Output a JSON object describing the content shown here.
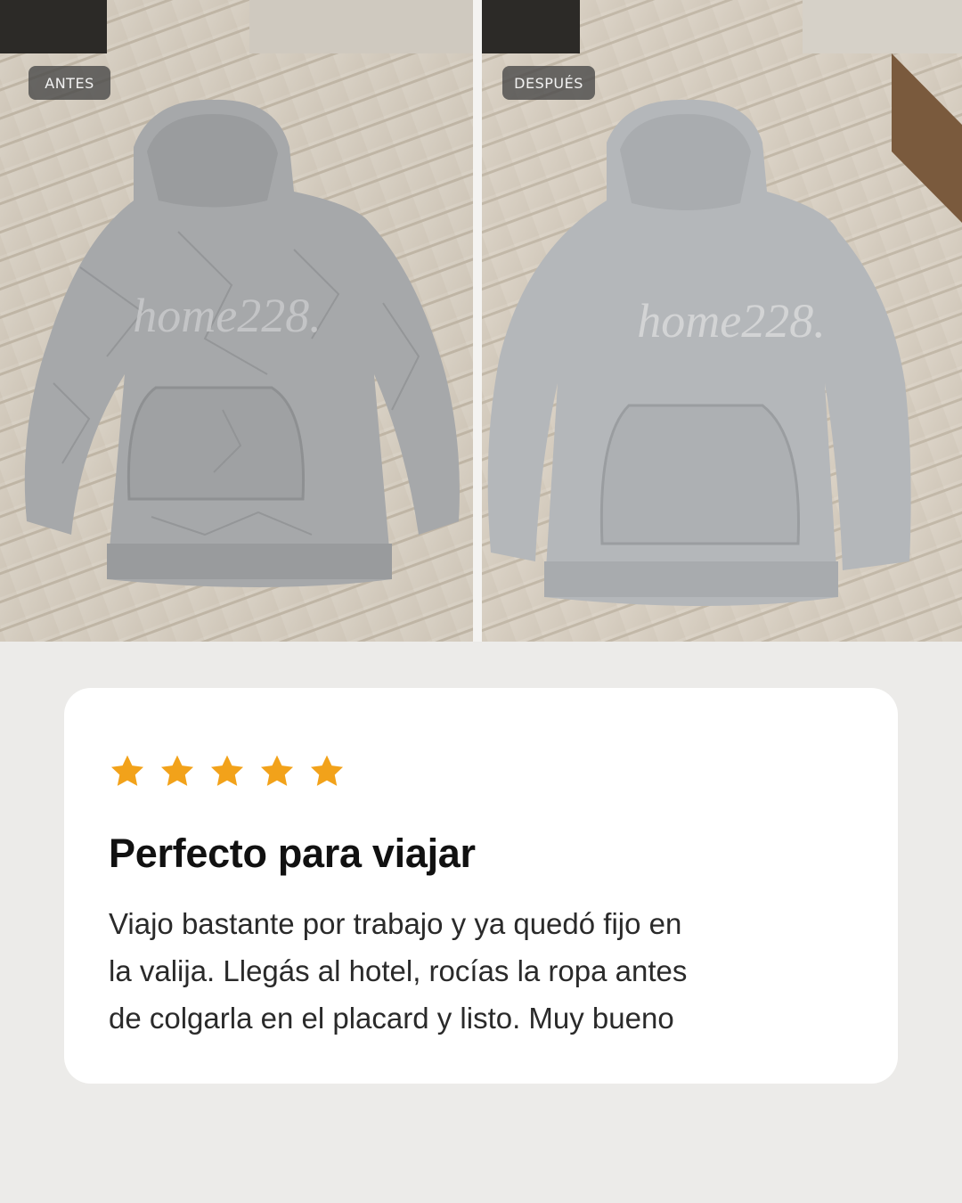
{
  "photos": {
    "before": {
      "label": "ANTES",
      "watermark": "home228."
    },
    "after": {
      "label": "DESPUÉS",
      "watermark": "home228."
    }
  },
  "review": {
    "rating": 5,
    "star_color": "#f2a21a",
    "title": "Perfecto para viajar",
    "body_lines": [
      "Viajo bastante por trabajo y ya quedó fijo en",
      "la valija. Llegás al hotel, rocías la ropa antes",
      "de colgarla en el placard y listo. Muy bueno"
    ]
  }
}
